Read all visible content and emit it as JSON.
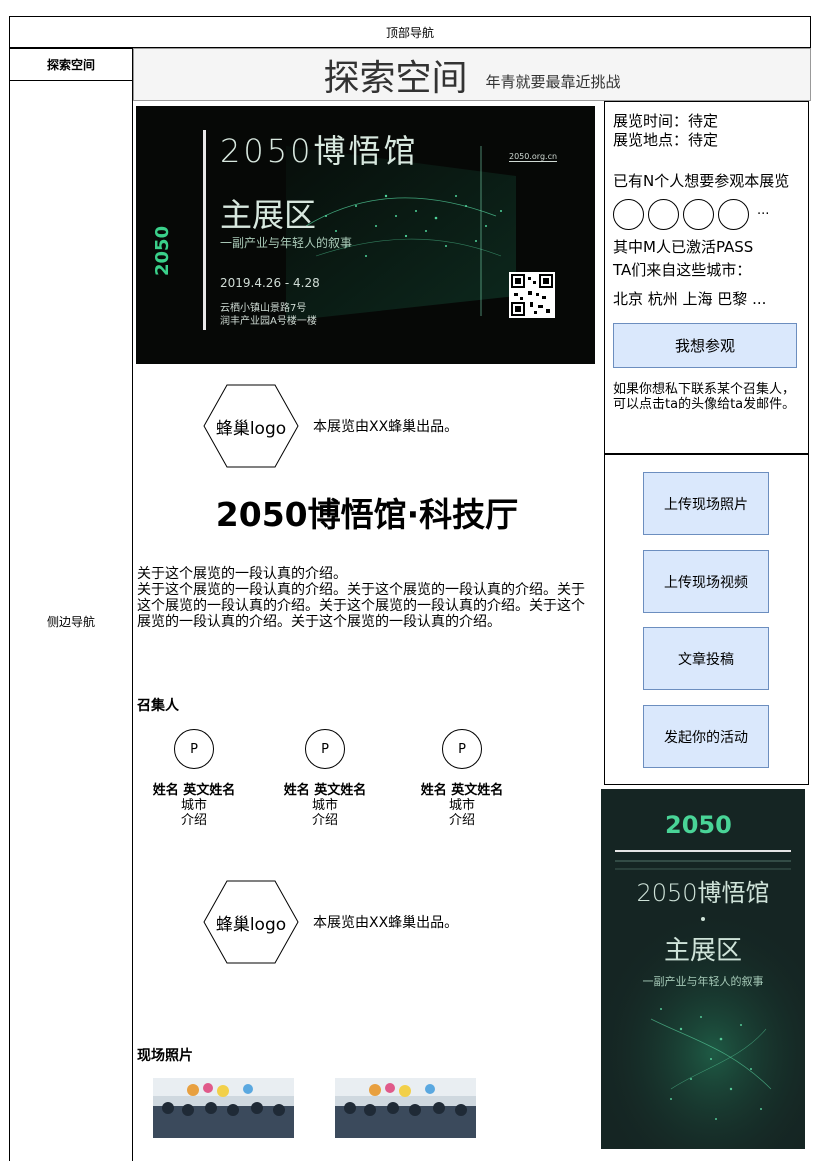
{
  "top_nav": {
    "label": "顶部导航"
  },
  "sidebar": {
    "title": "探索空间",
    "label": "侧边导航"
  },
  "header": {
    "title": "探索空间",
    "slogan": "年青就要最靠近挑战"
  },
  "poster": {
    "title": "2050博悟馆",
    "main": "主展区",
    "sub": "一副产业与年轻人的叙事",
    "date": "2019.4.26 - 4.28",
    "addr1": "云栖小镇山景路7号",
    "addr2": "润丰产业园A号楼一楼",
    "url": "2050.org.cn",
    "side_brand": "2050"
  },
  "producer": {
    "logo_label": "蜂巢logo",
    "note": "本展览由XX蜂巢出品。"
  },
  "exhibit": {
    "title": "2050博悟馆·科技厅",
    "intro_first": "关于这个展览的一段认真的介绍。",
    "intro_rest": "关于这个展览的一段认真的介绍。关于这个展览的一段认真的介绍。关于这个展览的一段认真的介绍。关于这个展览的一段认真的介绍。关于这个展览的一段认真的介绍。关于这个展览的一段认真的介绍。"
  },
  "organizers": {
    "label": "召集人",
    "people": [
      {
        "avatar": "P",
        "name": "姓名 英文姓名",
        "city": "城市",
        "intro": "介绍"
      },
      {
        "avatar": "P",
        "name": "姓名 英文姓名",
        "city": "城市",
        "intro": "介绍"
      },
      {
        "avatar": "P",
        "name": "姓名 英文姓名",
        "city": "城市",
        "intro": "介绍"
      }
    ]
  },
  "producer2": {
    "logo_label": "蜂巢logo",
    "note": "本展览由XX蜂巢出品。"
  },
  "photos": {
    "label": "现场照片"
  },
  "info": {
    "time": "展览时间：待定",
    "place": "展览地点：待定",
    "want_count": "已有N个人想要参观本展览",
    "more": "···",
    "activated": "其中M人已激活PASS",
    "cities_label": "TA们来自这些城市：",
    "cities": "北京 杭州 上海 巴黎 ...",
    "want_button": "我想参观",
    "hint": "如果你想私下联系某个召集人，可以点击ta的头像给ta发邮件。"
  },
  "actions": {
    "upload_photo": "上传现场照片",
    "upload_video": "上传现场视频",
    "submit_article": "文章投稿",
    "start_event": "发起你的活动"
  },
  "poster2": {
    "brand": "2050",
    "title": "2050博悟馆",
    "main": "主展区",
    "sub": "一副产业与年轻人的叙事"
  },
  "colors": {
    "button_fill": "#dae8fc",
    "button_border": "#6c8ebf",
    "header_bg": "#f5f5f5",
    "poster_bg": "#060806",
    "poster_green": "#3ad08a"
  }
}
